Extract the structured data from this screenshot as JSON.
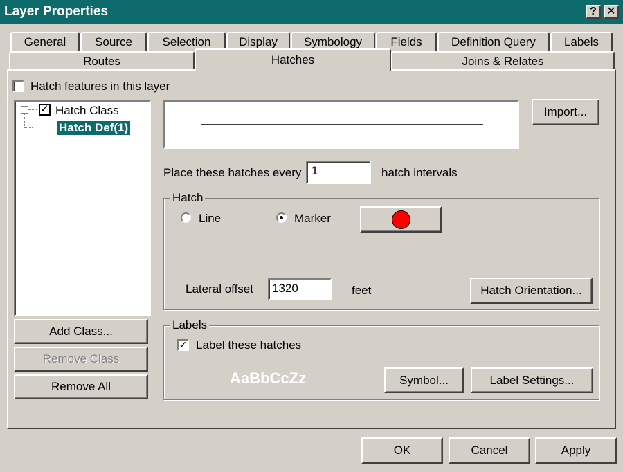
{
  "window": {
    "title": "Layer Properties",
    "help_label": "?",
    "close_label": "✕"
  },
  "tabs_row1": [
    "General",
    "Source",
    "Selection",
    "Display",
    "Symbology",
    "Fields",
    "Definition Query",
    "Labels"
  ],
  "tabs_row2": [
    "Routes",
    "Hatches",
    "Joins & Relates"
  ],
  "hatch_features_label": "Hatch features in this layer",
  "tree": {
    "expander": "−",
    "class_label": "Hatch Class",
    "def_label": "Hatch Def(1)"
  },
  "buttons": {
    "import": "Import...",
    "add_class": "Add Class...",
    "remove_class": "Remove Class",
    "remove_all": "Remove All",
    "hatch_orientation": "Hatch Orientation...",
    "symbol": "Symbol...",
    "label_settings": "Label Settings...",
    "ok": "OK",
    "cancel": "Cancel",
    "apply": "Apply"
  },
  "interval": {
    "prefix": "Place these hatches every",
    "value": "1",
    "suffix": "hatch intervals"
  },
  "hatch_group": {
    "title": "Hatch",
    "line_label": "Line",
    "marker_label": "Marker",
    "selected": "marker",
    "marker_color": "#ff0000",
    "offset_label": "Lateral offset",
    "offset_value": "1320",
    "offset_unit": "feet"
  },
  "labels_group": {
    "title": "Labels",
    "checkbox_label": "Label these hatches",
    "checked": true,
    "sample_text": "AaBbCcZz"
  },
  "colors": {
    "face": "#d4d0c8",
    "title_bar": "#0e6b6b",
    "selection": "#0e6b6b"
  }
}
